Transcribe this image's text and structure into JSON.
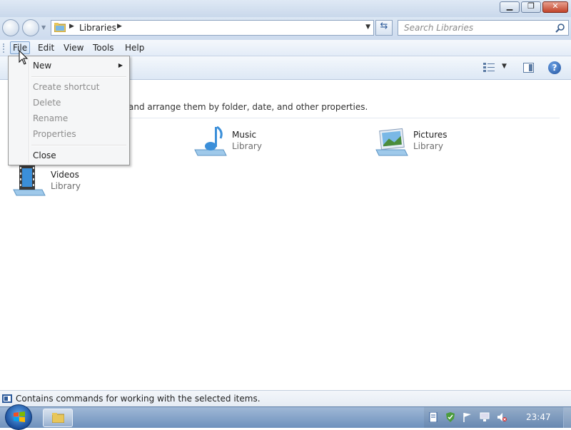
{
  "window": {
    "controls": [
      "minimize",
      "maximize",
      "close"
    ]
  },
  "navigation": {
    "address_path": "Libraries",
    "search_placeholder": "Search Libraries"
  },
  "menubar": {
    "items": [
      "File",
      "Edit",
      "View",
      "Tools",
      "Help"
    ],
    "active": "File"
  },
  "file_menu": {
    "items": [
      {
        "label": "New",
        "enabled": true,
        "submenu": true
      },
      {
        "label": "Create shortcut",
        "enabled": false
      },
      {
        "label": "Delete",
        "enabled": false
      },
      {
        "label": "Rename",
        "enabled": false
      },
      {
        "label": "Properties",
        "enabled": false
      },
      {
        "label": "Close",
        "enabled": true
      }
    ]
  },
  "content": {
    "description_partial": "and arrange them by folder, date, and other properties.",
    "libraries": [
      {
        "name": "Music",
        "type": "Library",
        "icon": "music-library-icon"
      },
      {
        "name": "Pictures",
        "type": "Library",
        "icon": "pictures-library-icon"
      },
      {
        "name": "Videos",
        "type": "Library",
        "icon": "videos-library-icon"
      }
    ]
  },
  "statusbar": {
    "text": "Contains commands for working with the selected items."
  },
  "taskbar": {
    "clock": "23:47"
  },
  "colors": {
    "accent": "#2d6ccf",
    "taskbar": "#7e9cc4"
  }
}
